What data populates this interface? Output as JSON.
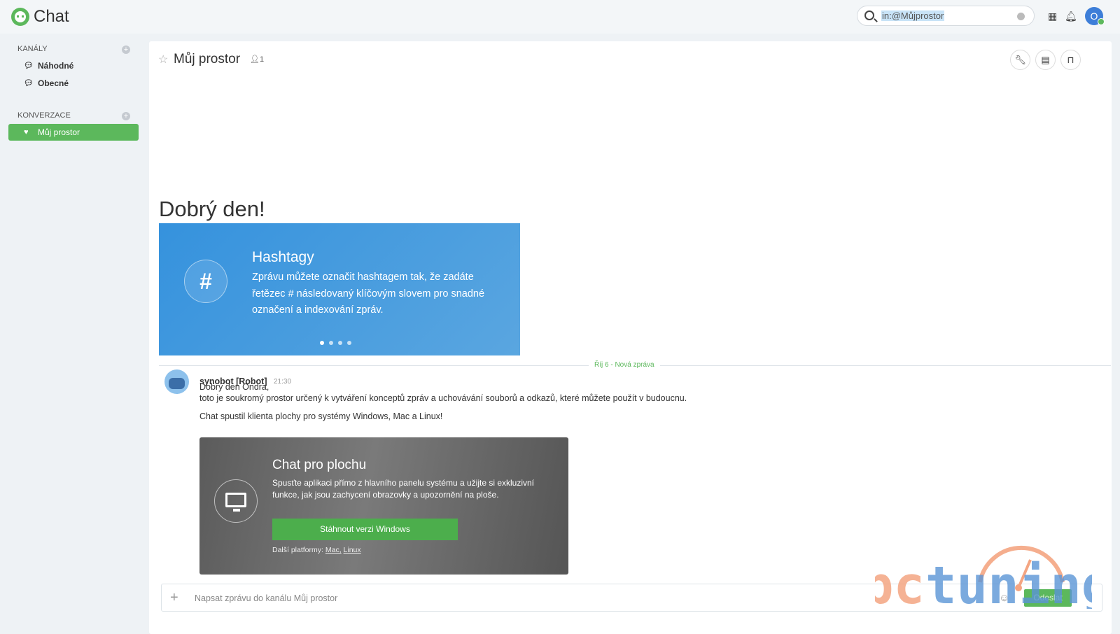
{
  "app": {
    "title": "Chat"
  },
  "search": {
    "value": "in:@Můjprostor"
  },
  "user": {
    "avatar_initial": "O"
  },
  "sidebar": {
    "channels_label": "KANÁLY",
    "channels": [
      {
        "label": "Náhodné"
      },
      {
        "label": "Obecné"
      }
    ],
    "conversations_label": "KONVERZACE",
    "conversations": [
      {
        "label": "Můj prostor",
        "active": true
      }
    ]
  },
  "channel": {
    "title": "Můj prostor",
    "member_count": "1"
  },
  "welcome": {
    "greeting": "Dobrý den!"
  },
  "carousel": {
    "title": "Hashtagy",
    "text": "Zprávu můžete označit hashtagem tak, že zadáte řetězec # následovaný klíčovým slovem pro snadné označení a indexování zpráv.",
    "slides": 4,
    "active_slide": 1
  },
  "divider": {
    "label": "Říj 6 - Nová zpráva"
  },
  "message": {
    "author": "synobot [Robot]",
    "time": "21:30",
    "line1": "Dobrý den Ondra,",
    "line2": "toto je soukromý prostor určený k vytváření konceptů zpráv a uchovávání souborů a odkazů, které můžete použít v budoucnu.",
    "line3": "Chat spustil klienta plochy pro systémy Windows, Mac a Linux!"
  },
  "desktop_card": {
    "title": "Chat pro plochu",
    "text": "Spusťte aplikaci přímo z hlavního panelu systému a užijte si exkluzivní funkce, jak jsou zachycení obrazovky a upozornění na ploše.",
    "button": "Stáhnout verzi Windows",
    "more_label": "Další platformy:",
    "mac": "Mac,",
    "linux": "Linux"
  },
  "composer": {
    "placeholder": "Napsat zprávu do kanálu Můj prostor",
    "send": "Odeslat"
  },
  "watermark": {
    "text": "pctuning"
  },
  "colors": {
    "accent": "#5cb85c",
    "card_blue": "#3592dd",
    "avatar": "#3d7ed8"
  }
}
